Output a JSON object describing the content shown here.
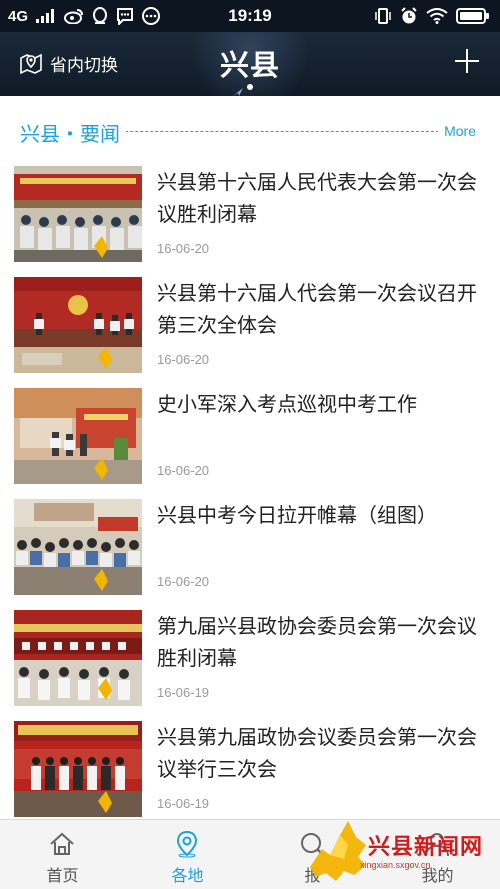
{
  "status_bar": {
    "network": "4G",
    "time": "19:19",
    "left_icons": [
      "signal-icon",
      "weibo-icon",
      "qq-icon",
      "chat-icon",
      "more-icon"
    ],
    "right_icons": [
      "vibrate-icon",
      "alarm-icon",
      "wifi-icon",
      "battery-icon"
    ]
  },
  "nav": {
    "location_label": "省内切换",
    "title": "兴县",
    "add_icon": "plus-icon"
  },
  "section": {
    "title": "兴县・要闻",
    "more_label": "More",
    "accent_color": "#1aa2dc"
  },
  "news": [
    {
      "title": "兴县第十六届人民代表大会第一次会议胜利闭幕",
      "date": "16-06-20"
    },
    {
      "title": "兴县第十六届人代会第一次会议召开第三次全体会",
      "date": "16-06-20"
    },
    {
      "title": "史小军深入考点巡视中考工作",
      "date": "16-06-20"
    },
    {
      "title": "兴县中考今日拉开帷幕（组图）",
      "date": "16-06-20"
    },
    {
      "title": "第九届兴县政协会委员会第一次会议胜利闭幕",
      "date": "16-06-19"
    },
    {
      "title": "兴县第九届政协会议委员会第一次会议举行三次会",
      "date": "16-06-19"
    }
  ],
  "tabs": [
    {
      "label": "首页",
      "icon": "home-icon",
      "active": false
    },
    {
      "label": "各地",
      "icon": "location-pin-icon",
      "active": true
    },
    {
      "label": "报",
      "icon": "report-icon",
      "active": false
    },
    {
      "label": "我的",
      "icon": "profile-icon",
      "active": false
    }
  ],
  "watermark": {
    "text": "兴县新闻网",
    "url": "xingxian.sxgov.cn"
  }
}
